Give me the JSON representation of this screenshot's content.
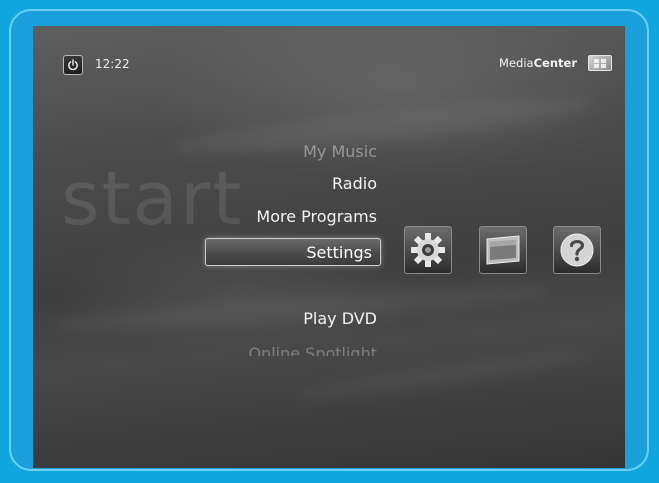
{
  "header": {
    "clock": "12:22",
    "brand_prefix": "Media",
    "brand_bold": "Center"
  },
  "background_text": "start",
  "menu": {
    "items": [
      {
        "label": "My Music"
      },
      {
        "label": "Radio"
      },
      {
        "label": "More Programs"
      },
      {
        "label": "Settings"
      },
      {
        "label": "Play DVD"
      },
      {
        "label": "Online Spotlight"
      }
    ],
    "selected": "Settings"
  },
  "quick_tiles": [
    {
      "icon": "gear-icon"
    },
    {
      "icon": "monitor-icon"
    },
    {
      "icon": "help-icon"
    }
  ],
  "colors": {
    "frame": "#1b9fdb",
    "screen": "#4a4a4a"
  }
}
